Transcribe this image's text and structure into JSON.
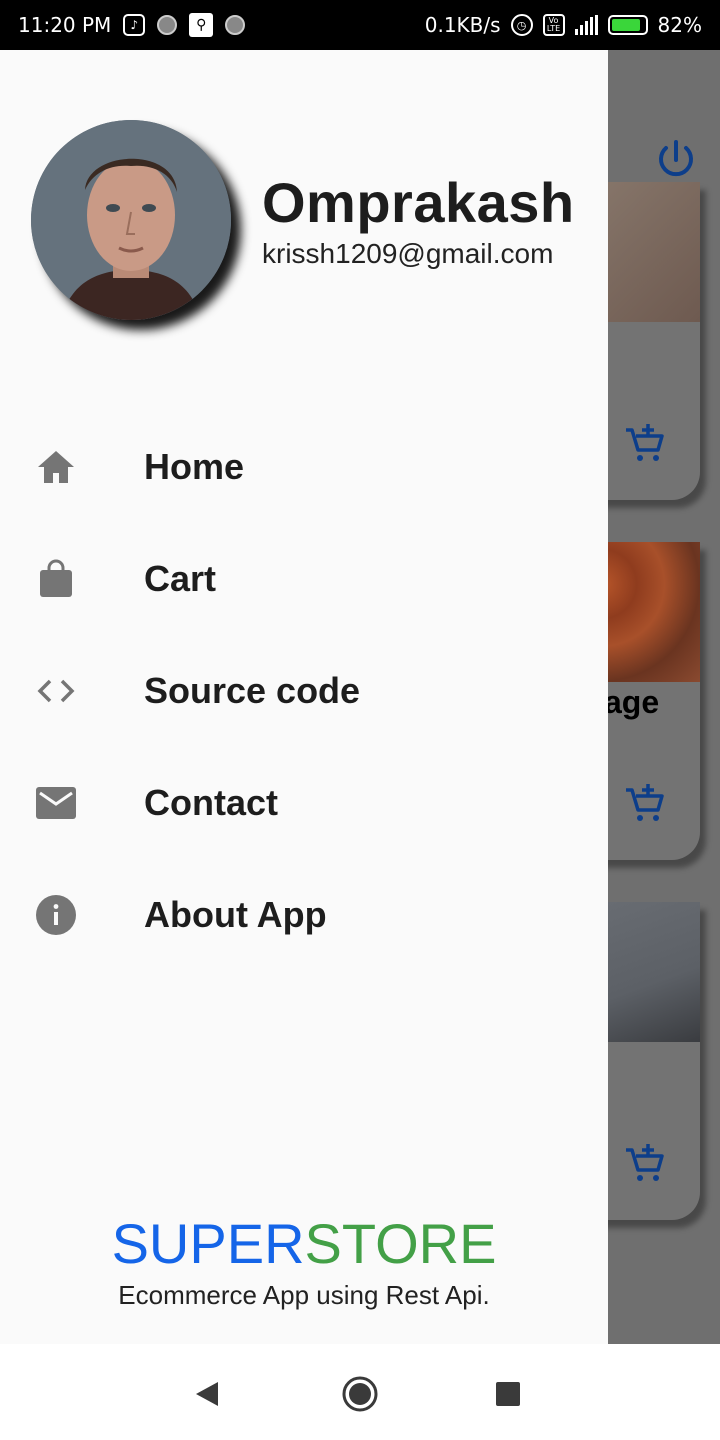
{
  "status_bar": {
    "time": "11:20 PM",
    "network_speed": "0.1KB/s",
    "battery_percent": "82%",
    "network_type": "4G"
  },
  "user": {
    "name": "Omprakash",
    "email": "krissh1209@gmail.com"
  },
  "menu": [
    {
      "label": "Home",
      "icon": "home-icon"
    },
    {
      "label": "Cart",
      "icon": "shopping-bag-icon"
    },
    {
      "label": "Source code",
      "icon": "code-icon"
    },
    {
      "label": "Contact",
      "icon": "mail-icon"
    },
    {
      "label": "About App",
      "icon": "info-icon"
    }
  ],
  "brand": {
    "part1": "SUPER",
    "part2": "STORE",
    "tagline": "Ecommerce App using Rest Api.",
    "color_part1": "#1565e8",
    "color_part2": "#43a047"
  },
  "background": {
    "card_title_fragment": "age"
  }
}
